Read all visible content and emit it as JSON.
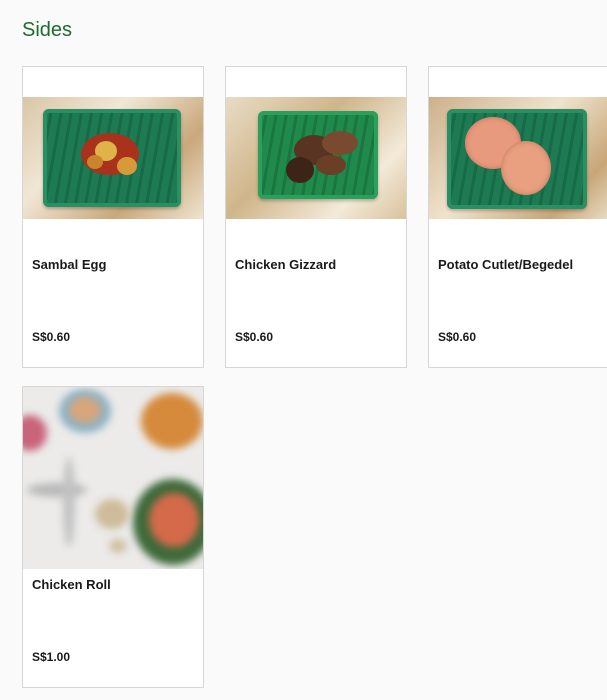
{
  "section": {
    "title": "Sides"
  },
  "items": [
    {
      "name": "Sambal Egg",
      "price": "S$0.60"
    },
    {
      "name": "Chicken Gizzard",
      "price": "S$0.60"
    },
    {
      "name": "Potato Cutlet/Begedel",
      "price": "S$0.60"
    },
    {
      "name": "Chicken Roll",
      "price": "S$1.00"
    }
  ],
  "colors": {
    "title": "#1e6b2e",
    "plate": "#1d7a52",
    "card_border": "#d6d6d6"
  }
}
